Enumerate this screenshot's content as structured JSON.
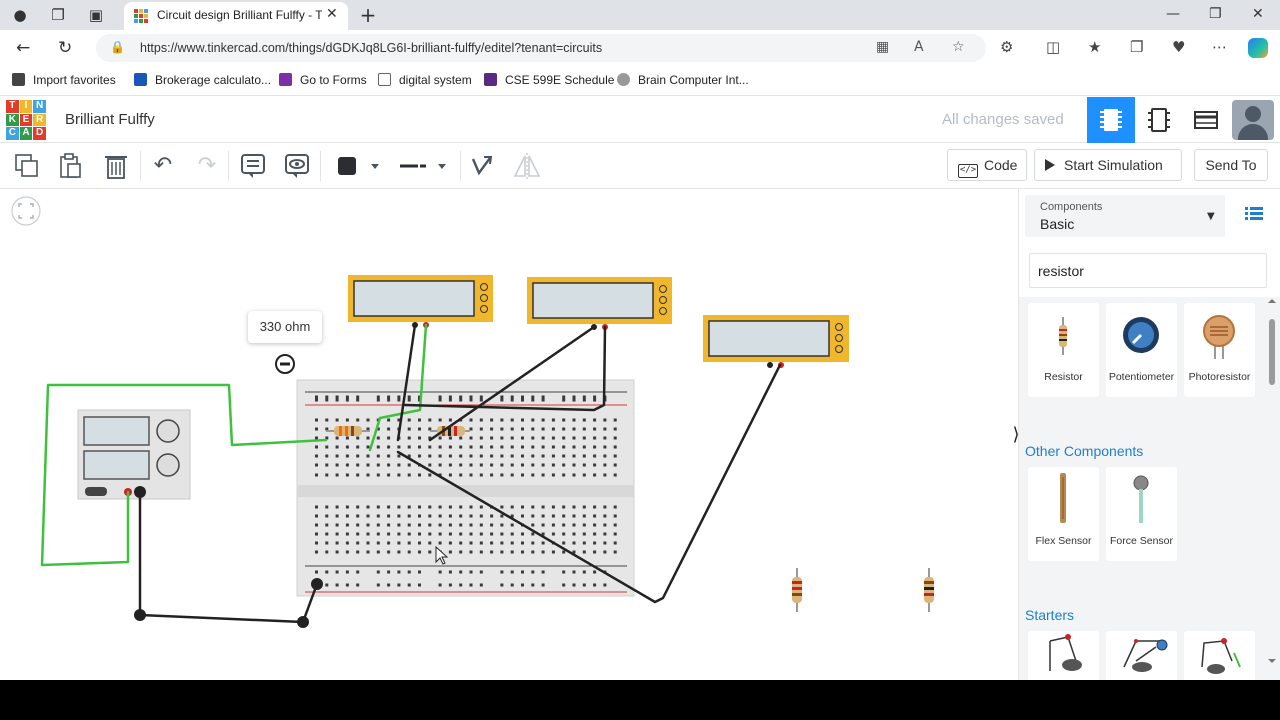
{
  "browser": {
    "tab_title": "Circuit design Brilliant Fulffy - Tinkercad",
    "url": "https://www.tinkercad.com/things/dGDKJq8LG6I-brilliant-fulffy/editel?tenant=circuits",
    "favorites": [
      {
        "label": "Import favorites",
        "icon": "import-icon",
        "color": "#444444"
      },
      {
        "label": "Brokerage calculato...",
        "icon": "bookmark-blue-icon",
        "color": "#1a56b8"
      },
      {
        "label": "Go to Forms",
        "icon": "forms-icon",
        "color": "#7b2fa8"
      },
      {
        "label": "digital system",
        "icon": "document-icon",
        "color": "#666666"
      },
      {
        "label": "CSE 599E Schedule",
        "icon": "w-logo-icon",
        "color": "#5a2a82"
      },
      {
        "label": "Brain Computer Int...",
        "icon": "gear-icon",
        "color": "#777777"
      }
    ]
  },
  "app": {
    "design_name": "Brilliant Fulffy",
    "save_status": "All changes saved"
  },
  "toolbar": {
    "code_label": "Code",
    "simulate_label": "Start Simulation",
    "send_label": "Send To"
  },
  "canvas": {
    "tooltip_value": "330 ohm"
  },
  "panel": {
    "components_label": "Components",
    "components_value": "Basic",
    "search_value": "resistor",
    "basic_items": [
      "Resistor",
      "Potentiometer",
      "Photoresistor"
    ],
    "other_title": "Other Components",
    "other_items": [
      "Flex Sensor",
      "Force Sensor"
    ],
    "starters_title": "Starters"
  },
  "colors": {
    "accent": "#1e90ff",
    "wire_green": "#3ec23e",
    "wire_black": "#222222",
    "multimeter": "#f0b62c"
  }
}
